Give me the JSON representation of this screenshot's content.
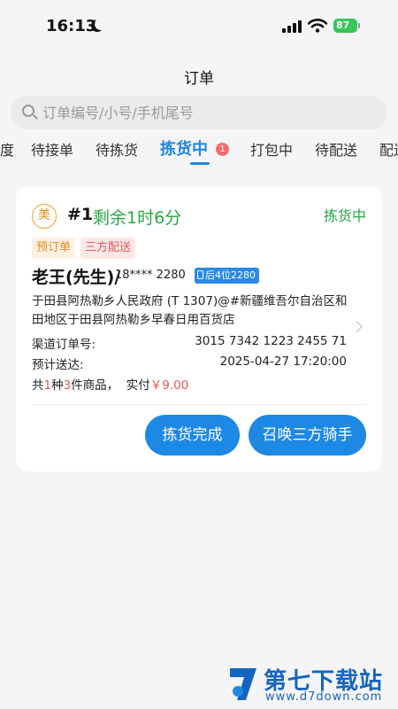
{
  "status_bar": {
    "time": "16:13",
    "battery": "87"
  },
  "header": {
    "title": "订单"
  },
  "search": {
    "placeholder": "订单编号/小号/手机尾号"
  },
  "tabs": [
    {
      "label": "度"
    },
    {
      "label": "待接单"
    },
    {
      "label": "待拣货"
    },
    {
      "label": "拣货中",
      "badge": "1",
      "active": true
    },
    {
      "label": "打包中"
    },
    {
      "label": "待配送"
    },
    {
      "label": "配送"
    }
  ],
  "order": {
    "store_icon": "美",
    "number": "#1",
    "remaining": "剩余1时6分",
    "status": "拣货中",
    "tags": [
      "预订单",
      "三方配送"
    ],
    "customer_name": "老王(先生)/",
    "phone": "18**** 2280",
    "phone_tail": "后4位2280",
    "address": "于田县阿热勒乡人民政府 (T 1307)@#新疆维吾尔自治区和田地区于田县阿热勒乡早春日用百货店",
    "channel_label": "渠道订单号:",
    "channel_value": "3015 7342 1223 2455 71",
    "eta_label": "预计送达:",
    "eta_value": "2025-04-27 17:20:00",
    "summary": {
      "prefix": "共",
      "kinds": "1",
      "kinds_unit": "种",
      "count": "3",
      "count_unit": "件商品，",
      "paid_label": "实付",
      "paid_value": "￥9.00"
    },
    "buttons": {
      "pick_done": "拣货完成",
      "call_rider": "召唤三方骑手"
    }
  },
  "watermark": {
    "name": "第七下载站",
    "url": "www.d7down.com"
  },
  "colors": {
    "accent": "#1e88e5",
    "green": "#27a844",
    "red": "#e25757",
    "orange": "#e08a1e"
  }
}
